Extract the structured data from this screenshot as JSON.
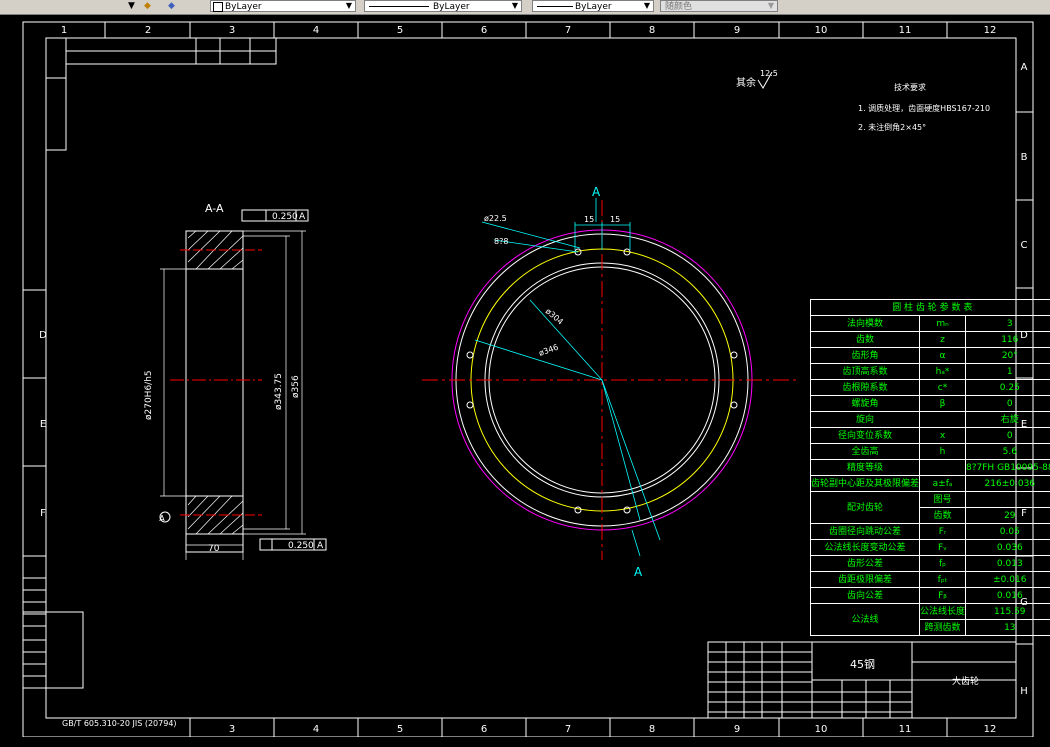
{
  "toolbar": {
    "layer_combo": "ByLayer",
    "linetype_combo": "ByLayer",
    "lineweight_combo": "ByLayer",
    "color_combo": "随颜色"
  },
  "frame": {
    "top_numbers": [
      "1",
      "2",
      "3",
      "4",
      "5",
      "6",
      "7",
      "8",
      "9",
      "10",
      "11",
      "12"
    ],
    "bottom_numbers": [
      "3",
      "4",
      "5",
      "6",
      "7",
      "8",
      "9",
      "10",
      "11",
      "12"
    ],
    "right_letters": [
      "A",
      "B",
      "C",
      "D",
      "E",
      "F",
      "G",
      "H"
    ],
    "left_letters": [
      "D",
      "E",
      "F"
    ]
  },
  "drawing": {
    "section_label": "A-A",
    "section_mark": "A",
    "tolerance_top": "0.250",
    "tolerance_top_ref": "A",
    "tolerance_bottom": "0.250",
    "tolerance_bottom_ref": "A",
    "dim_bore": "ø270H6/h5",
    "dim_inner": "ø343.75",
    "dim_outer": "ø356",
    "dim_width": "70",
    "dim_r2": "ø22.5",
    "dim_r3": "8?8",
    "dim_15a": "15",
    "dim_15b": "15",
    "dim_d1": "ø304",
    "dim_d2": "ø346",
    "roughness_rest": "其余",
    "roughness_value": "12.5",
    "material": "45钢",
    "part_name": "大齿轮",
    "bottom_note": "GB/T 605.310-20 JIS (20794)"
  },
  "tech_requirements": {
    "title": "技术要求",
    "item1": "1. 调质处理，齿面硬度HBS167-210",
    "item2": "2. 未注倒角2×45°"
  },
  "param_table": {
    "title": "圆 柱 齿 轮 参 数 表",
    "rows": [
      {
        "name": "法向模数",
        "sym": "mₙ",
        "val": "3"
      },
      {
        "name": "齿数",
        "sym": "z",
        "val": "116"
      },
      {
        "name": "齿形角",
        "sym": "α",
        "val": "20°"
      },
      {
        "name": "齿顶高系数",
        "sym": "hₐ*",
        "val": "1"
      },
      {
        "name": "齿根隙系数",
        "sym": "c*",
        "val": "0.25"
      },
      {
        "name": "螺旋角",
        "sym": "β",
        "val": "0"
      },
      {
        "name": "旋向",
        "sym": "",
        "val": "右旋"
      },
      {
        "name": "径向变位系数",
        "sym": "x",
        "val": "0"
      },
      {
        "name": "全齿高",
        "sym": "h",
        "val": "5.6"
      },
      {
        "name": "精度等级",
        "sym": "",
        "val": "8?7FH GB10095-88"
      },
      {
        "name": "齿轮副中心距及其极限偏差",
        "sym": "a±fₐ",
        "val": "216±0.036"
      },
      {
        "name": "配对齿轮 图号",
        "sym": "",
        "val": ""
      },
      {
        "name": "配对齿轮 齿数",
        "sym": "",
        "val": "29"
      },
      {
        "name": "齿圈径向跳动公差",
        "sym": "Fᵣ",
        "val": "0.05"
      },
      {
        "name": "公法线长度变动公差",
        "sym": "Fᵥ",
        "val": "0.036"
      },
      {
        "name": "齿形公差",
        "sym": "fₚ",
        "val": "0.013"
      },
      {
        "name": "齿距极限偏差",
        "sym": "fₚₜ",
        "val": "±0.016"
      },
      {
        "name": "齿向公差",
        "sym": "Fᵦ",
        "val": "0.016"
      },
      {
        "name": "公法线 公法线长度",
        "sym": "Wₖ",
        "val": "115.59"
      },
      {
        "name": "公法线 跨测齿数",
        "sym": "k",
        "val": "13"
      }
    ],
    "pair_label": "配对齿轮",
    "pair_sub1": "图号",
    "pair_sub2": "齿数",
    "wk_label": "公法线",
    "wk_sub1": "公法线长度",
    "wk_sub2": "跨测齿数"
  },
  "colors": {
    "frame": "#ffffff",
    "text": "#00ff00",
    "center": "#ff0000",
    "dim": "#00ffff",
    "pitch": "#ffff00",
    "outer": "#ff00ff"
  }
}
